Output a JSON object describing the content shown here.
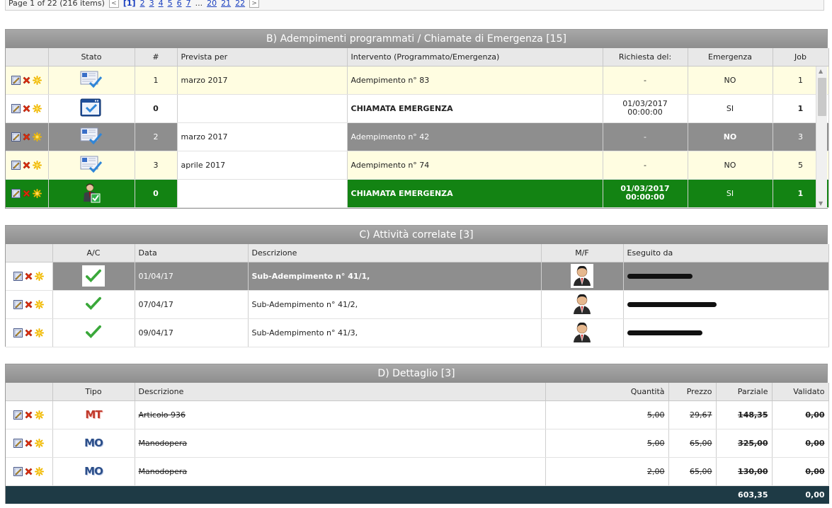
{
  "pager": {
    "summary": "Page 1 of 22 (216 items)",
    "prev": "<",
    "pages": [
      "[1]",
      "2",
      "3",
      "4",
      "5",
      "6",
      "7",
      "...",
      "20",
      "21",
      "22"
    ],
    "next": ">"
  },
  "panelB": {
    "title": "B) Adempimenti programmati / Chiamate di Emergenza [15]",
    "headers": [
      "Stato",
      "#",
      "Prevista per",
      "Intervento (Programmato/Emergenza)",
      "Richiesta del:",
      "Emergenza",
      "Job"
    ],
    "rows": [
      {
        "num": "1",
        "prevista": "marzo 2017",
        "intervento": "Adempimento n° 83",
        "richiesta": "-",
        "emergenza": "NO",
        "job": "1"
      },
      {
        "num": "0",
        "prevista": "",
        "intervento": "CHIAMATA EMERGENZA",
        "richiesta": "01/03/2017\n00:00:00",
        "emergenza": "SI",
        "job": "1"
      },
      {
        "num": "2",
        "prevista": "marzo 2017",
        "intervento": "Adempimento n° 42",
        "richiesta": "-",
        "emergenza": "NO",
        "job": "3"
      },
      {
        "num": "3",
        "prevista": "aprile 2017",
        "intervento": "Adempimento n° 74",
        "richiesta": "-",
        "emergenza": "NO",
        "job": "5"
      },
      {
        "num": "0",
        "prevista": "",
        "intervento": "CHIAMATA EMERGENZA",
        "richiesta": "01/03/2017\n00:00:00",
        "emergenza": "SI",
        "job": "1"
      }
    ]
  },
  "panelC": {
    "title": "C) Attività correlate [3]",
    "headers": [
      "A/C",
      "Data",
      "Descrizione",
      "M/F",
      "Eseguito da"
    ],
    "rows": [
      {
        "data": "01/04/17",
        "descrizione": "Sub-Adempimento n° 41/1,"
      },
      {
        "data": "07/04/17",
        "descrizione": "Sub-Adempimento n° 41/2,"
      },
      {
        "data": "09/04/17",
        "descrizione": "Sub-Adempimento n° 41/3,"
      }
    ]
  },
  "panelD": {
    "title": "D) Dettaglio [3]",
    "headers": [
      "Tipo",
      "Descrizione",
      "Quantità",
      "Prezzo",
      "Parziale",
      "Validato"
    ],
    "rows": [
      {
        "tipo": "MT",
        "descrizione": "Articolo 936",
        "quantita": "5,00",
        "prezzo": "29,67",
        "parziale": "148,35",
        "validato": "0,00"
      },
      {
        "tipo": "MO",
        "descrizione": "Manodopera",
        "quantita": "5,00",
        "prezzo": "65,00",
        "parziale": "325,00",
        "validato": "0,00"
      },
      {
        "tipo": "MO",
        "descrizione": "Manodopera",
        "quantita": "2,00",
        "prezzo": "65,00",
        "parziale": "130,00",
        "validato": "0,00"
      }
    ],
    "total_parziale": "603,35",
    "total_validato": "0,00"
  },
  "icons": {
    "edit": "edit-icon",
    "delete": "delete-icon",
    "star": "star-icon",
    "check": "checkmark-icon",
    "user": "user-avatar-icon"
  }
}
